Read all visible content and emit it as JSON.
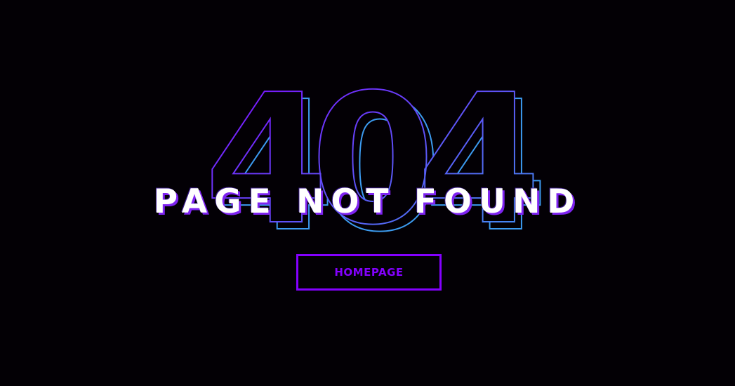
{
  "error": {
    "code": "404",
    "message": "PAGE NOT FOUND"
  },
  "actions": {
    "home_label": "HOMEPAGE"
  },
  "colors": {
    "background": "#030005",
    "accent": "#8400ff",
    "outline_gradient_start": "#8400ff",
    "outline_gradient_end": "#3c9bf0",
    "headline": "#ffffff"
  }
}
